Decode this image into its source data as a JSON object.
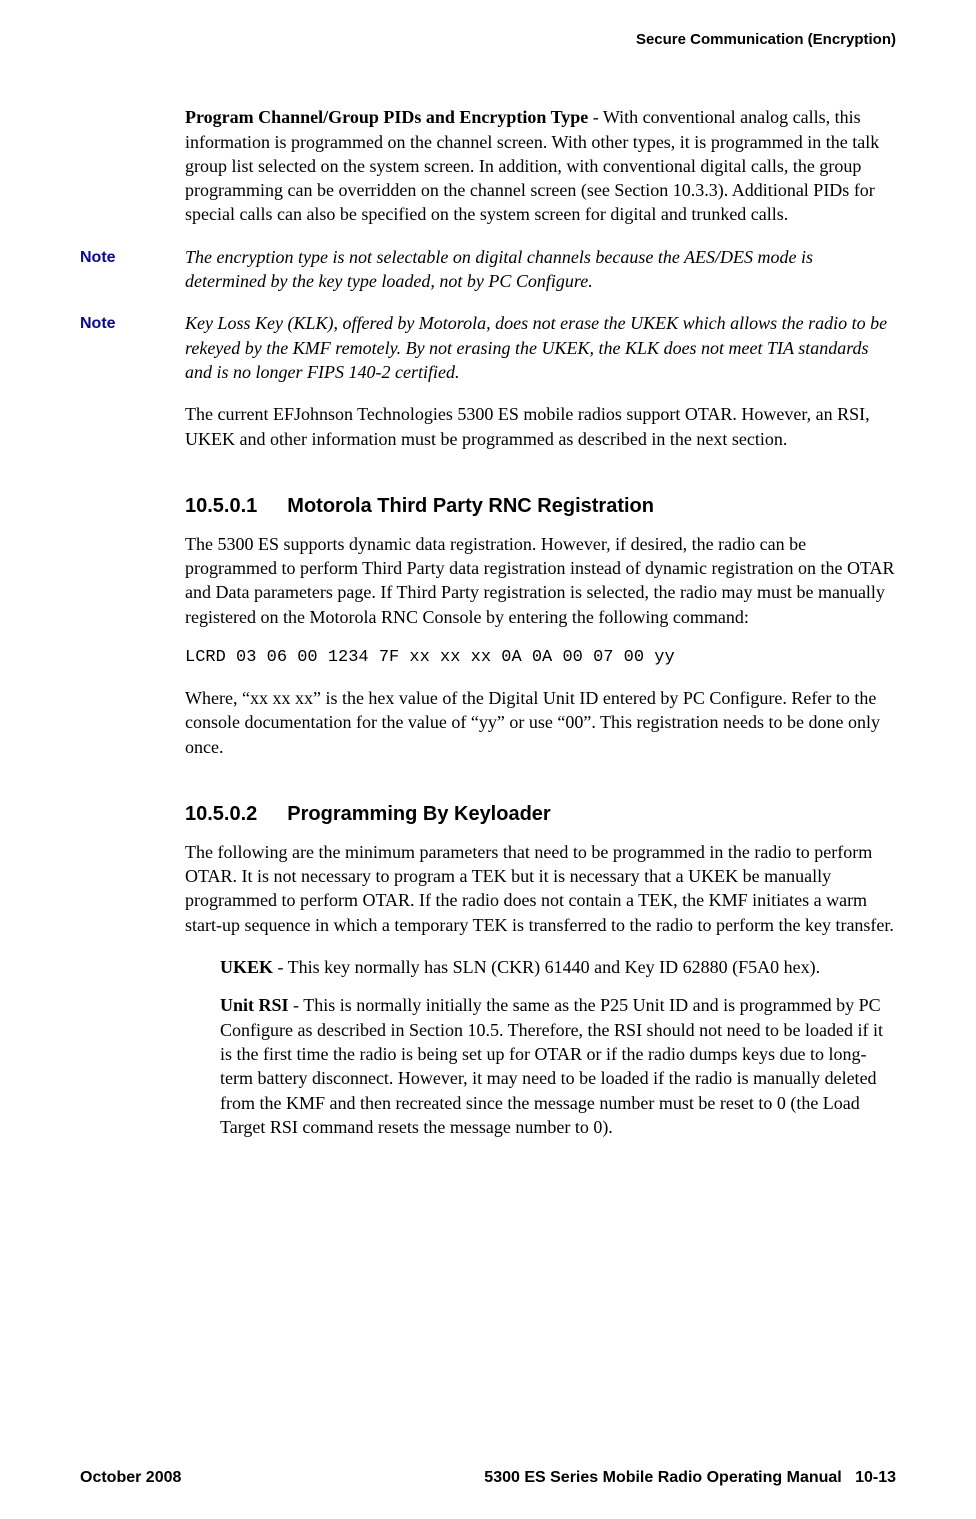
{
  "header": {
    "running_title": "Secure Communication (Encryption)"
  },
  "paragraphs": {
    "p1_bold": "Program Channel/Group PIDs and Encryption Type",
    "p1_rest": " - With conventional analog calls, this information is programmed on the channel screen. With other types, it is programmed in the talk group list selected on the system screen. In addition, with conventional digital calls, the group programming can be overridden on the channel screen (see Section 10.3.3). Additional PIDs for special calls can also be specified on the system screen for digital and trunked calls.",
    "note1_label": "Note",
    "note1_text": "The encryption type is not selectable on digital channels because the AES/DES mode is determined by the key type loaded, not by PC Configure.",
    "note2_label": "Note",
    "note2_text": "Key Loss Key (KLK), offered by Motorola, does not erase the UKEK which allows the radio to be rekeyed by the KMF remotely. By not erasing the UKEK, the KLK does not meet TIA standards and is no longer FIPS 140-2 certified.",
    "p2": "The current EFJohnson Technologies 5300 ES mobile radios support OTAR. However, an RSI, UKEK and other information must be programmed as described in the next section."
  },
  "sections": {
    "s1": {
      "number": "10.5.0.1",
      "title": "Motorola Third Party RNC Registration",
      "body1": "The 5300 ES supports dynamic data registration. However, if desired, the radio can be programmed to perform Third Party data registration instead of dynamic registration on the OTAR and Data parameters page. If Third Party registration is selected, the radio may must be manually registered on the Motorola RNC Console by entering the following command:",
      "code": "LCRD 03 06 00 1234 7F xx xx xx 0A 0A 00 07 00 yy",
      "body2": "Where, “xx xx xx” is the hex value of the Digital Unit ID entered by PC Configure. Refer to the console documentation for the value of “yy” or use “00”. This registration needs to be done only once."
    },
    "s2": {
      "number": "10.5.0.2",
      "title": "Programming By Keyloader",
      "body1": "The following are the minimum parameters that need to be programmed in the radio to perform OTAR. It is not necessary to program a TEK but it is necessary that a UKEK be manually programmed to perform OTAR. If the radio does not contain a TEK, the KMF initiates a warm start-up sequence in which a temporary TEK is transferred to the radio to perform the key transfer.",
      "item1_bold": "UKEK",
      "item1_rest": " - This key normally has SLN (CKR) 61440 and Key ID 62880 (F5A0 hex).",
      "item2_bold": "Unit RSI",
      "item2_rest": " - This is normally initially the same as the P25 Unit ID and is programmed by PC Configure as described in Section 10.5. Therefore, the RSI should not need to be loaded if it is the first time the radio is being set up for OTAR or if the radio dumps keys due to long-term battery disconnect. However, it may need to be loaded if the radio is manually deleted from the KMF and then recreated since the message number must be reset to 0 (the Load Target RSI command resets the message number to 0)."
    }
  },
  "footer": {
    "left": "October 2008",
    "right_manual": "5300 ES Series Mobile Radio Operating Manual",
    "right_page": "10-13"
  }
}
